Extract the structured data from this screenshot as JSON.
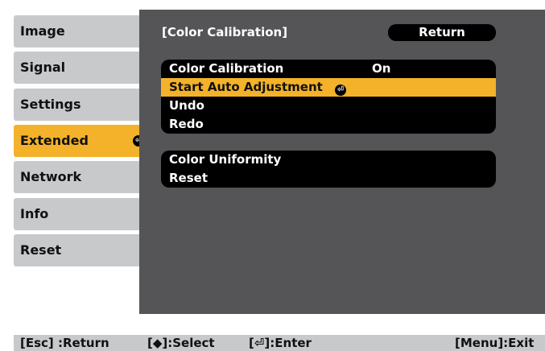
{
  "sidebar": {
    "items": [
      {
        "label": "Image"
      },
      {
        "label": "Signal"
      },
      {
        "label": "Settings"
      },
      {
        "label": "Extended",
        "selected": true
      },
      {
        "label": "Network"
      },
      {
        "label": "Info"
      },
      {
        "label": "Reset"
      }
    ]
  },
  "panel": {
    "title": "[Color Calibration]",
    "return_label": "Return",
    "block1": [
      {
        "label": "Color Calibration",
        "value": "On"
      },
      {
        "label": "Start Auto Adjustment",
        "selected": true
      },
      {
        "label": "Undo"
      },
      {
        "label": "Redo"
      }
    ],
    "block2": [
      {
        "label": "Color Uniformity"
      },
      {
        "label": "Reset"
      }
    ]
  },
  "footer": {
    "esc": "[Esc] :Return",
    "select": "[◆]:Select",
    "enter": "[⏎]:Enter",
    "menu": "[Menu]:Exit"
  },
  "colors": {
    "accent": "#f3b229",
    "panel_bg": "#555557",
    "tab_bg": "#c7c9cb"
  },
  "icons": [
    "enter-icon"
  ]
}
